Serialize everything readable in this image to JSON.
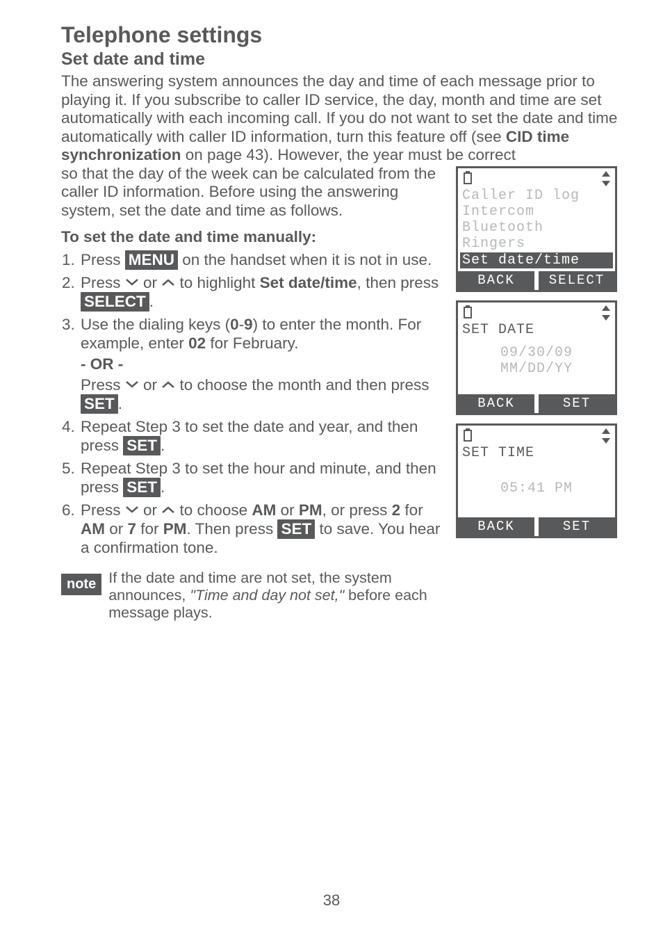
{
  "title": "Telephone settings",
  "subtitle": "Set date and time",
  "intro_a": "The answering system announces the day and time of each message prior to playing it. If you subscribe to caller ID service, the day, month and time are set automatically with each incoming call. If you do not want to set the date and time automatically with caller ID information, turn this feature off (see ",
  "intro_bold": "CID time synchronization",
  "intro_b": " on page 43). However, the year must be correct ",
  "intro2": "so that the day of the week can be calculated from the caller ID information. Before using the answering system, set the date and time as follows.",
  "howto": "To set the date and time manually:",
  "step1_a": "Press ",
  "btn_menu": "MENU",
  "step1_b": " on the handset when it is not in use.",
  "step2_a": "Press ",
  "step2_b": " or ",
  "step2_c": " to highlight ",
  "step2_bold": "Set date/time",
  "step2_d": ", then press ",
  "btn_select": "SELECT",
  "step3_a": "Use the dialing keys (",
  "step3_bold1": "0",
  "step3_dash": "-",
  "step3_bold2": "9",
  "step3_b": ") to enter the month. For example, enter ",
  "step3_bold3": "02",
  "step3_c": " for February.",
  "or_label": "- OR -",
  "step3_alt_a": "Press ",
  "step3_alt_b": " or ",
  "step3_alt_c": " to choose the month and then press ",
  "btn_set": "SET",
  "step4_a": "Repeat Step 3 to set the date and year, and then press ",
  "step5_a": "Repeat Step 3 to set the hour and minute, and then press ",
  "step6_a": "Press ",
  "step6_b": " or ",
  "step6_c": " to choose ",
  "step6_am": "AM",
  "step6_or": " or ",
  "step6_pm": "PM",
  "step6_d": ", or press ",
  "step6_two": "2",
  "step6_e": " for ",
  "step6_f": " or ",
  "step6_seven": "7",
  "step6_g": " for ",
  "step6_h": ". Then press ",
  "step6_i": " to save. You hear a confirmation tone.",
  "note_label": "note",
  "note_a": "If the date and time are not set, the system announces, ",
  "note_italic": "\"Time and day not set,\"",
  "note_b": " before each message plays.",
  "lcd1": {
    "l1": "Caller ID log",
    "l2": "Intercom",
    "l3": "Bluetooth",
    "l4": "Ringers",
    "sel": "Set date/time",
    "sk_left": "BACK",
    "sk_right": "SELECT"
  },
  "lcd2": {
    "title": "SET DATE",
    "v1": "09/30/09",
    "v2": "MM/DD/YY",
    "sk_left": "BACK",
    "sk_right": "SET"
  },
  "lcd3": {
    "title": "SET TIME",
    "v1": "05:41 PM",
    "sk_left": "BACK",
    "sk_right": "SET"
  },
  "page_number": "38"
}
